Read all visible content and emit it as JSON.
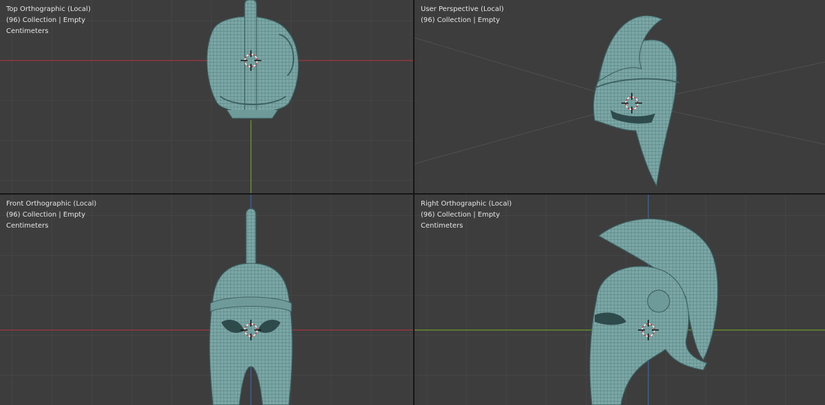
{
  "viewports": {
    "top": {
      "view_name": "Top Orthographic (Local)",
      "collection": "(96) Collection | Empty",
      "units": "Centimeters"
    },
    "persp": {
      "view_name": "User Perspective (Local)",
      "collection": "(96) Collection | Empty"
    },
    "front": {
      "view_name": "Front Orthographic (Local)",
      "collection": "(96) Collection | Empty",
      "units": "Centimeters"
    },
    "right": {
      "view_name": "Right Orthographic (Local)",
      "collection": "(96) Collection | Empty",
      "units": "Centimeters"
    }
  },
  "colors": {
    "viewport_bg": "#3d3d3d",
    "grid": "#4a4a4a",
    "x_axis": "#a33a42",
    "y_axis": "#6d9a2f",
    "z_axis": "#3a65a6",
    "mesh_fill": "#7aa6a6",
    "mesh_wire": "#3f6262",
    "text": "#e6e6e6"
  },
  "icons": [
    "3d-cursor-icon"
  ]
}
